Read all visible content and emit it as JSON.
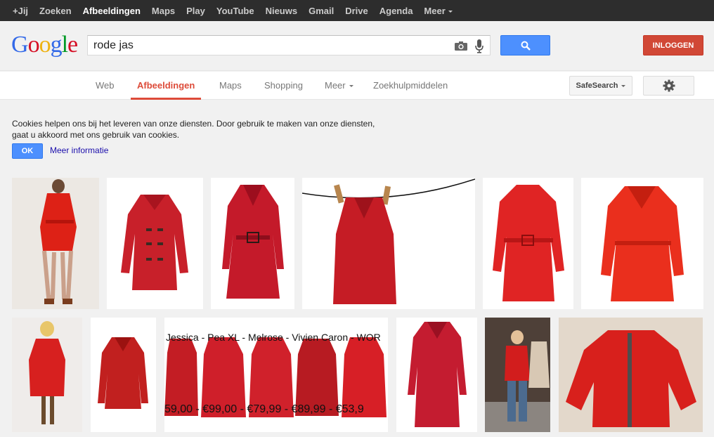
{
  "topbar": {
    "items": [
      {
        "label": "+Jij"
      },
      {
        "label": "Zoeken"
      },
      {
        "label": "Afbeeldingen"
      },
      {
        "label": "Maps"
      },
      {
        "label": "Play"
      },
      {
        "label": "YouTube"
      },
      {
        "label": "Nieuws"
      },
      {
        "label": "Gmail"
      },
      {
        "label": "Drive"
      },
      {
        "label": "Agenda"
      },
      {
        "label": "Meer"
      }
    ]
  },
  "header": {
    "logo": "Google",
    "search_value": "rode jas",
    "login_label": "INLOGGEN"
  },
  "nav": {
    "tabs": [
      {
        "label": "Web"
      },
      {
        "label": "Afbeeldingen"
      },
      {
        "label": "Maps"
      },
      {
        "label": "Shopping"
      },
      {
        "label": "Meer"
      },
      {
        "label": "Zoekhulpmiddelen"
      }
    ],
    "safesearch_label": "SafeSearch"
  },
  "cookie": {
    "text": "Cookies helpen ons bij het leveren van onze diensten. Door gebruik te maken van onze diensten, gaat u akkoord met ons gebruik van cookies.",
    "ok_label": "OK",
    "more_label": "Meer informatie"
  },
  "results": {
    "collage_top": "Jessica - Pea XL - Melrose - Vivien Caron - WOR",
    "collage_bottom": "59,00 - €99,00 - €79,99 - €89,99 - €53,9"
  },
  "colors": {
    "topbar": "#2d2d2d",
    "search_button": "#4d90fe",
    "login_button": "#d14836",
    "active_tab": "#dd4b39",
    "coat_red": "#d11a1a"
  }
}
